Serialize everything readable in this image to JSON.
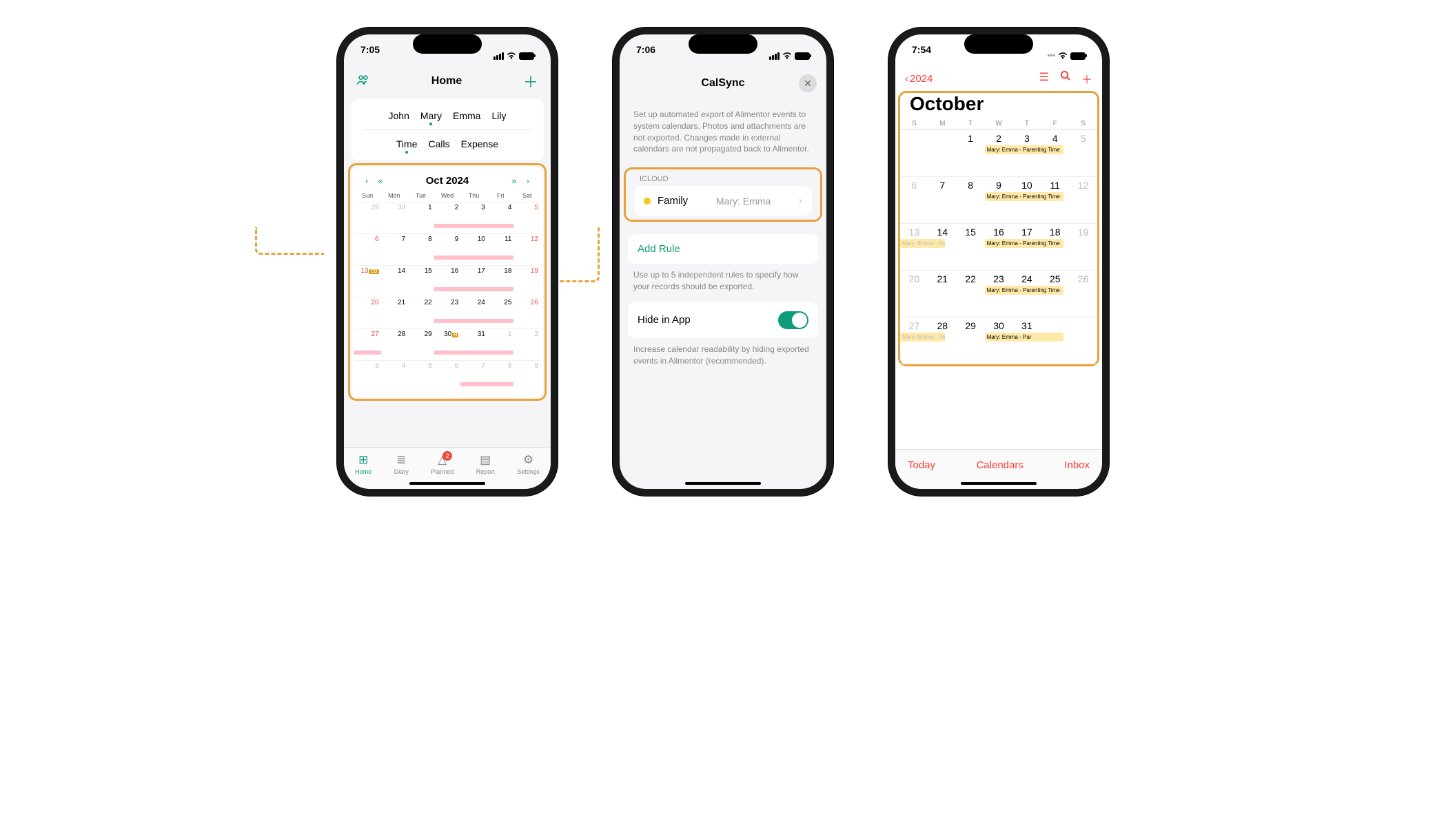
{
  "phone1": {
    "time": "7:05",
    "title": "Home",
    "people": [
      "John",
      "Mary",
      "Emma",
      "Lily"
    ],
    "subtabs": [
      "Time",
      "Calls",
      "Expense"
    ],
    "active_person": 1,
    "active_subtab": 0,
    "cal_month": "Oct 2024",
    "dow": [
      "Sun",
      "Mon",
      "Tue",
      "Wed",
      "Thu",
      "Fri",
      "Sat"
    ],
    "weeks": [
      [
        {
          "d": "29",
          "dim": true
        },
        {
          "d": "30",
          "dim": true
        },
        {
          "d": "1"
        },
        {
          "d": "2",
          "bar": true
        },
        {
          "d": "3",
          "bar": true
        },
        {
          "d": "4",
          "bar": true
        },
        {
          "d": "5",
          "red": true
        }
      ],
      [
        {
          "d": "6",
          "red": true
        },
        {
          "d": "7"
        },
        {
          "d": "8"
        },
        {
          "d": "9",
          "bar": true
        },
        {
          "d": "10",
          "bar": true
        },
        {
          "d": "11",
          "bar": true
        },
        {
          "d": "12",
          "red": true
        }
      ],
      [
        {
          "d": "13",
          "red": true,
          "badge": "CD"
        },
        {
          "d": "14"
        },
        {
          "d": "15"
        },
        {
          "d": "16",
          "bar": true
        },
        {
          "d": "17",
          "bar": true
        },
        {
          "d": "18",
          "bar": true
        },
        {
          "d": "19",
          "red": true
        }
      ],
      [
        {
          "d": "20",
          "red": true
        },
        {
          "d": "21"
        },
        {
          "d": "22"
        },
        {
          "d": "23",
          "bar": true
        },
        {
          "d": "24",
          "bar": true
        },
        {
          "d": "25",
          "bar": true
        },
        {
          "d": "26",
          "red": true
        }
      ],
      [
        {
          "d": "27",
          "red": true,
          "bar": true
        },
        {
          "d": "28"
        },
        {
          "d": "29"
        },
        {
          "d": "30",
          "badge": "H",
          "bar": true
        },
        {
          "d": "31",
          "bar": true
        },
        {
          "d": "1",
          "dim": true,
          "bar": true
        },
        {
          "d": "2",
          "dim": true
        }
      ],
      [
        {
          "d": "3",
          "dim": true
        },
        {
          "d": "4",
          "dim": true
        },
        {
          "d": "5",
          "dim": true
        },
        {
          "d": "6",
          "dim": true
        },
        {
          "d": "7",
          "dim": true,
          "bar": true
        },
        {
          "d": "8",
          "dim": true,
          "bar": true
        },
        {
          "d": "9",
          "dim": true
        }
      ]
    ],
    "nav": [
      {
        "label": "Home",
        "icon": "⊞",
        "active": true
      },
      {
        "label": "Diary",
        "icon": "≣"
      },
      {
        "label": "Planned",
        "icon": "△",
        "badge": "2"
      },
      {
        "label": "Report",
        "icon": "▤"
      },
      {
        "label": "Settings",
        "icon": "⚙"
      }
    ]
  },
  "phone2": {
    "time": "7:06",
    "title": "CalSync",
    "description": "Set up automated export of Alimentor events to system calendars. Photos and attachments are not exported. Changes made in external calendars are not propagated back to Alimentor.",
    "section": "ICLOUD",
    "family_label": "Family",
    "family_right": "Mary: Emma",
    "add_rule": "Add Rule",
    "rule_desc": "Use up to 5 independent rules to specify how your records should be exported.",
    "hide_label": "Hide in App",
    "hide_desc": "Increase calendar readability by hiding exported events in Alimentor (recommended)."
  },
  "phone3": {
    "time": "7:54",
    "back": "2024",
    "month": "October",
    "dow": [
      "S",
      "M",
      "T",
      "W",
      "T",
      "F",
      "S"
    ],
    "weeks": [
      [
        {
          "d": ""
        },
        {
          "d": ""
        },
        {
          "d": "1"
        },
        {
          "d": "2",
          "ev": "Mary: Emma - Parenting Time"
        },
        {
          "d": "3"
        },
        {
          "d": "4"
        },
        {
          "d": "5",
          "dim": true
        }
      ],
      [
        {
          "d": "6",
          "dim": true
        },
        {
          "d": "7"
        },
        {
          "d": "8"
        },
        {
          "d": "9",
          "ev": "Mary: Emma - Parenting Time"
        },
        {
          "d": "10"
        },
        {
          "d": "11"
        },
        {
          "d": "12",
          "dim": true
        }
      ],
      [
        {
          "d": "13",
          "dim": true,
          "ev2": "Mary: Emma - Par"
        },
        {
          "d": "14"
        },
        {
          "d": "15"
        },
        {
          "d": "16",
          "ev": "Mary: Emma - Parenting Time"
        },
        {
          "d": "17"
        },
        {
          "d": "18"
        },
        {
          "d": "19",
          "dim": true
        }
      ],
      [
        {
          "d": "20",
          "dim": true
        },
        {
          "d": "21"
        },
        {
          "d": "22"
        },
        {
          "d": "23",
          "ev": "Mary: Emma - Parenting Time"
        },
        {
          "d": "24"
        },
        {
          "d": "25"
        },
        {
          "d": "26",
          "dim": true
        }
      ],
      [
        {
          "d": "27",
          "dim": true,
          "ev2": "Mary: Emma - Par"
        },
        {
          "d": "28"
        },
        {
          "d": "29"
        },
        {
          "d": "30",
          "ev": "Mary: Emma - Par"
        },
        {
          "d": "31"
        },
        {
          "d": ""
        },
        {
          "d": ""
        }
      ]
    ],
    "bottom": [
      "Today",
      "Calendars",
      "Inbox"
    ]
  }
}
